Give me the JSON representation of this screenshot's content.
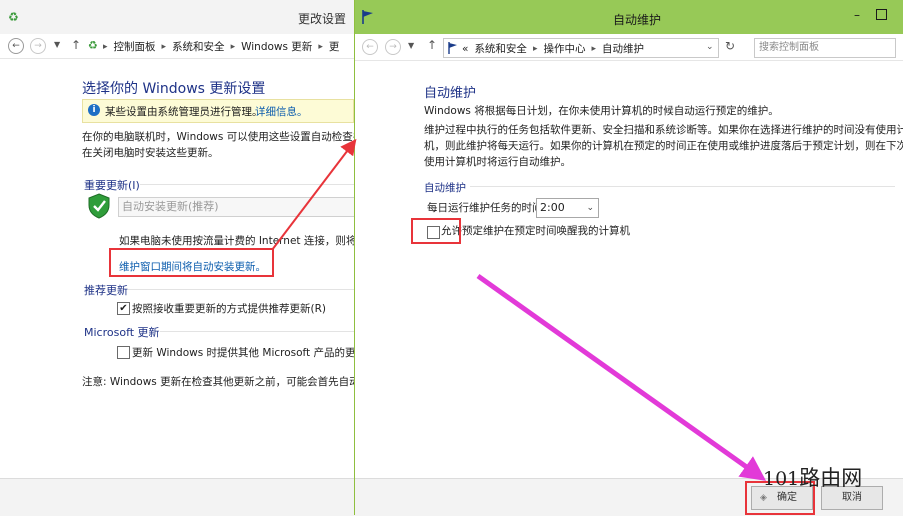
{
  "back_window": {
    "title": "更改设置",
    "breadcrumb": [
      "控制面板",
      "系统和安全",
      "Windows 更新",
      "更"
    ],
    "heading": "选择你的 Windows 更新设置",
    "info_text": "某些设置由系统管理员进行管理。",
    "info_link": "详细信息。",
    "desc_line1": "在你的电脑联机时，Windows 可以使用这些设置自动检查并",
    "desc_line2": "在关闭电脑时安装这些更新。",
    "important_updates_label": "重要更新(I)",
    "important_updates_value": "自动安装更新(推荐)",
    "metered_text": "如果电脑未使用按流量计费的 Internet 连接，则将在",
    "maintenance_link": "维护窗口期间将自动安装更新。",
    "recommended_label": "推荐更新",
    "recommended_checkbox": "按照接收重要更新的方式提供推荐更新(R)",
    "microsoft_label": "Microsoft 更新",
    "microsoft_checkbox": "更新 Windows 时提供其他 Microsoft 产品的更新",
    "note": "注意: Windows 更新在检查其他更新之前，可能会首先自动进"
  },
  "front_window": {
    "title": "自动维护",
    "breadcrumb_prefix": "«",
    "breadcrumb": [
      "系统和安全",
      "操作中心",
      "自动维护"
    ],
    "search_placeholder": "搜索控制面板",
    "heading": "自动维护",
    "intro": "Windows 将根据每日计划，在你未使用计算机的时候自动运行预定的维护。",
    "desc_line1": "维护过程中执行的任务包括软件更新、安全扫描和系统诊断等。如果你在选择进行维护的时间没有使用计算",
    "desc_line2": "机，则此维护将每天运行。如果你的计算机在预定的时间正在使用或维护进度落后于预定计划，则在下次不",
    "desc_line3": "使用计算机时将运行自动维护。",
    "section_label": "自动维护",
    "run_time_label": "每日运行维护任务的时间",
    "run_time_value": "2:00",
    "wake_checkbox": "允许预定维护在预定时间唤醒我的计算机",
    "ok_button": "确定",
    "cancel_button": "取消"
  },
  "watermark": {
    "number": "101",
    "text": "路由网"
  },
  "colors": {
    "accent_green": "#97c957",
    "annotation_red": "#e8343a",
    "arrow_magenta": "#e23ad8",
    "heading_blue": "#1e3287",
    "link_blue": "#0b5cad"
  }
}
